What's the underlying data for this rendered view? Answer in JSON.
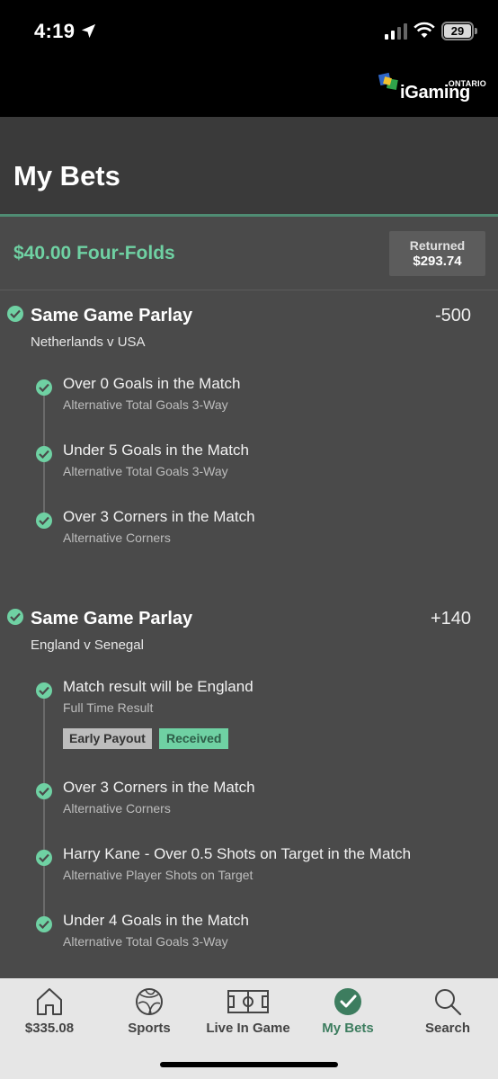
{
  "status_bar": {
    "time": "4:19",
    "battery": "29"
  },
  "brand": {
    "name": "iGaming",
    "region": "ONTARIO"
  },
  "header": {
    "title": "My Bets"
  },
  "summary": {
    "stake_title": "$40.00 Four-Folds",
    "returned_label": "Returned",
    "returned_value": "$293.74"
  },
  "bets": [
    {
      "title": "Same Game Parlay",
      "odds": "-500",
      "match": "Netherlands v USA",
      "legs": [
        {
          "title": "Over 0 Goals in the Match",
          "market": "Alternative Total Goals 3-Way"
        },
        {
          "title": "Under 5 Goals in the Match",
          "market": "Alternative Total Goals 3-Way"
        },
        {
          "title": "Over 3 Corners in the Match",
          "market": "Alternative Corners"
        }
      ]
    },
    {
      "title": "Same Game Parlay",
      "odds": "+140",
      "match": "England v Senegal",
      "legs": [
        {
          "title": "Match result will be England",
          "market": "Full Time Result",
          "badges": [
            "Early Payout",
            "Received"
          ]
        },
        {
          "title": "Over 3 Corners in the Match",
          "market": "Alternative Corners"
        },
        {
          "title": "Harry Kane - Over 0.5 Shots on Target in the Match",
          "market": "Alternative Player Shots on Target"
        },
        {
          "title": "Under 4 Goals in the Match",
          "market": "Alternative Total Goals 3-Way"
        }
      ]
    }
  ],
  "tabbar": {
    "items": [
      {
        "label": "$335.08",
        "icon": "home-icon"
      },
      {
        "label": "Sports",
        "icon": "soccer-ball-icon"
      },
      {
        "label": "Live In Game",
        "icon": "pitch-icon"
      },
      {
        "label": "My Bets",
        "icon": "check-circle-icon",
        "active": true
      },
      {
        "label": "Search",
        "icon": "search-icon"
      }
    ]
  },
  "colors": {
    "accent": "#6fd1a3",
    "header": "#3a3a3a",
    "background": "#4a4a4a",
    "tabbar": "#e6e6e6"
  }
}
